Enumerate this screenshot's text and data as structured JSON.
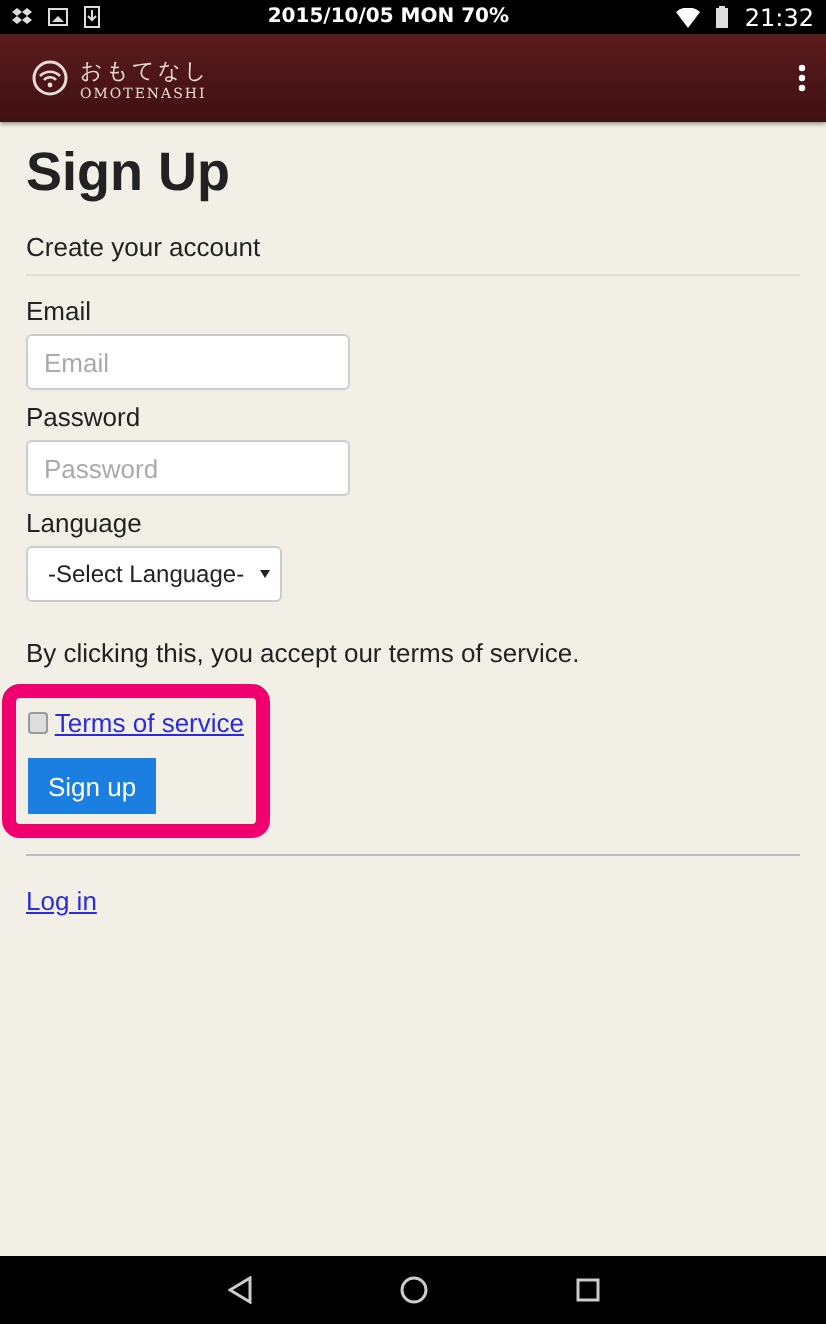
{
  "status_bar": {
    "center": "2015/10/05 MON 70%",
    "time": "21:32"
  },
  "app_bar": {
    "title": "おもてなし",
    "subtitle": "OMOTENASHI"
  },
  "page": {
    "heading": "Sign Up",
    "subheading": "Create your account"
  },
  "fields": [
    {
      "label": "Email",
      "kind": "input",
      "placeholder": "Email"
    },
    {
      "label": "Password",
      "kind": "input",
      "placeholder": "Password"
    },
    {
      "label": "Language",
      "kind": "select",
      "value": "-Select Language-"
    }
  ],
  "terms_note": "By clicking this, you accept our terms of service.",
  "terms": {
    "label": "Terms of service",
    "checked": false
  },
  "submit": "Sign up",
  "login_link": "Log in"
}
